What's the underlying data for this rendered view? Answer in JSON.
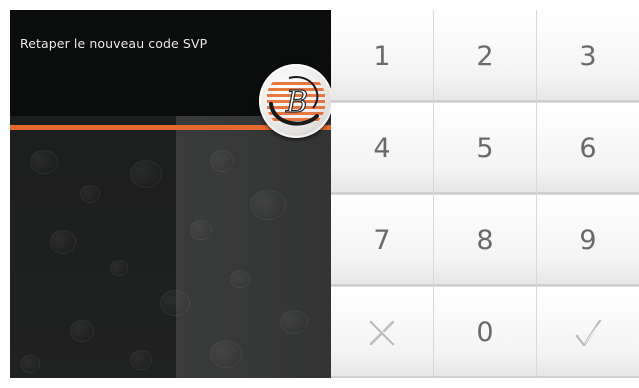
{
  "screen": {
    "prompt": "Retaper le nouveau code SVP",
    "entry_value": ""
  },
  "logo": {
    "icon": "brand-logo-b-icon",
    "letter": "B"
  },
  "keypad": {
    "keys": [
      {
        "label": "1"
      },
      {
        "label": "2"
      },
      {
        "label": "3"
      },
      {
        "label": "4"
      },
      {
        "label": "5"
      },
      {
        "label": "6"
      },
      {
        "label": "7"
      },
      {
        "label": "8"
      },
      {
        "label": "9"
      },
      {
        "label": "",
        "icon": "clear-x-icon"
      },
      {
        "label": "0"
      },
      {
        "label": "",
        "icon": "confirm-check-icon"
      }
    ]
  },
  "colors": {
    "accent": "#e46a2e",
    "panel_dark": "#2b2c2c",
    "key_text": "#6a6a6a"
  }
}
